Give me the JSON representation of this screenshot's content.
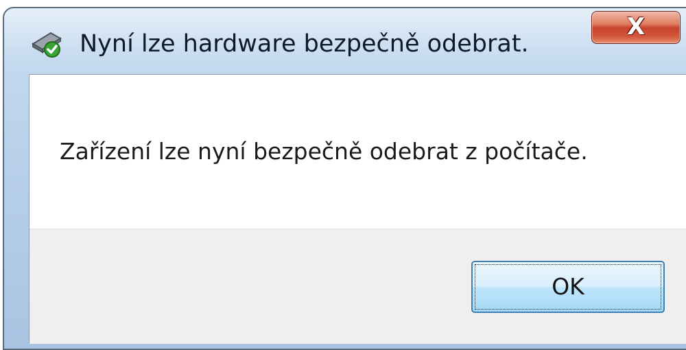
{
  "window": {
    "title": "Nyní lze hardware bezpečně odebrat.",
    "title_icon": "safely-remove-hardware-icon",
    "close_icon": "close-icon",
    "close_glyph": "X"
  },
  "dialog": {
    "message": "Zařízení lze nyní bezpečně odebrat z počítače."
  },
  "buttons": {
    "ok_label": "OK"
  },
  "colors": {
    "frame": "#b8d0ea",
    "close_button": "#c7432b",
    "ok_border": "#3c7fb1",
    "footer": "#efefef"
  }
}
